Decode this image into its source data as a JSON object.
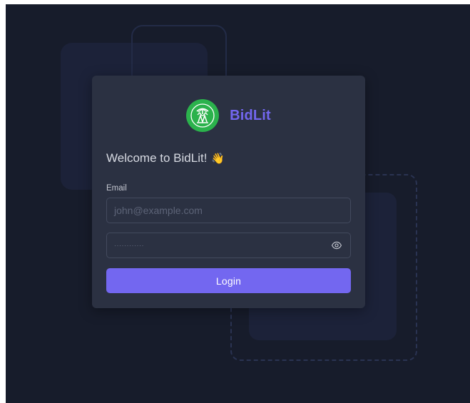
{
  "brand": {
    "name": "BidLit",
    "logo_icon": "bidlit-logo-icon",
    "accent_color": "#7367f0",
    "logo_color": "#2bb24c"
  },
  "welcome": {
    "text": "Welcome to BidLit!",
    "emoji": "👋"
  },
  "form": {
    "email_label": "Email",
    "email_placeholder": "john@example.com",
    "email_value": "",
    "password_masked": "············",
    "password_toggle_icon": "eye-icon",
    "login_label": "Login"
  }
}
